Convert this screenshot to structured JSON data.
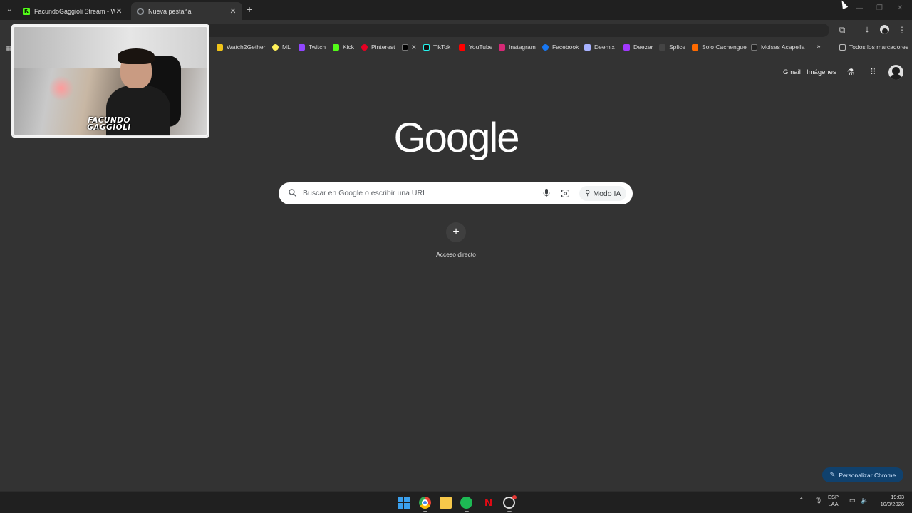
{
  "browser": {
    "tabs": [
      {
        "title": "FacundoGaggioli Stream - Watc",
        "favicon": "kick-icon",
        "active": false
      },
      {
        "title": "Nueva pestaña",
        "favicon": "chrome-icon",
        "active": true
      }
    ],
    "new_tab_symbol": "+",
    "bookmarks": [
      {
        "label": "Watch2Gether",
        "icon_color": "#f0c419"
      },
      {
        "label": "ML",
        "icon_color": "#fff159"
      },
      {
        "label": "Twitch",
        "icon_color": "#9146ff"
      },
      {
        "label": "Kick",
        "icon_color": "#53fc18"
      },
      {
        "label": "Pinterest",
        "icon_color": "#e60023"
      },
      {
        "label": "X",
        "icon_color": "#000000"
      },
      {
        "label": "TikTok",
        "icon_color": "#111111"
      },
      {
        "label": "YouTube",
        "icon_color": "#ff0000"
      },
      {
        "label": "Instagram",
        "icon_color": "#d62976"
      },
      {
        "label": "Facebook",
        "icon_color": "#1877f2"
      },
      {
        "label": "Deemix",
        "icon_color": "#a7b2ff"
      },
      {
        "label": "Deezer",
        "icon_color": "#a238ff"
      },
      {
        "label": "Splice",
        "icon_color": "#444444"
      },
      {
        "label": "Solo Cachengue",
        "icon_color": "#ff6a00"
      },
      {
        "label": "Moises Acapella",
        "icon_color": "#222222"
      }
    ],
    "bookmarks_more": "»",
    "all_bookmarks": "Todos los marcadores"
  },
  "webcam": {
    "overlay_logo_line1": "FACUNDO",
    "overlay_logo_line2": "GAGGIOLI"
  },
  "ntp": {
    "gmail": "Gmail",
    "images": "Imágenes",
    "logo": "Google",
    "search_placeholder": "Buscar en Google o escribir una URL",
    "ai_mode": "Modo IA",
    "shortcut_symbol": "+",
    "shortcut_label": "Acceso directo",
    "customize": "Personalizar Chrome"
  },
  "taskbar": {
    "lang_line1": "ESP",
    "lang_line2": "LAA",
    "time": "19:03",
    "date": "10/3/2026"
  },
  "colors": {
    "page_bg": "#333333",
    "tabstrip_bg": "#202020",
    "customize_bg": "#10416d",
    "taskbar_bg": "#202020"
  }
}
